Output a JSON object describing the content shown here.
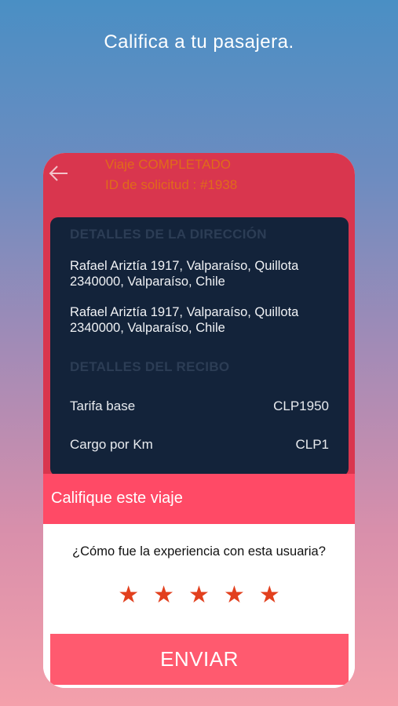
{
  "headline": "Califica a tu pasajera.",
  "trip": {
    "status": "Viaje COMPLETADO",
    "request_id": "ID de solicitud : #1938"
  },
  "address_section": {
    "title": "DETALLES DE LA DIRECCIÓN",
    "pickup": "Rafael Ariztía 1917, Valparaíso, Quillota 2340000, Valparaíso, Chile",
    "dropoff": "Rafael Ariztía 1917, Valparaíso, Quillota 2340000, Valparaíso, Chile"
  },
  "receipt_section": {
    "title": "DETALLES DEL RECIBO",
    "rows": [
      {
        "label": "Tarifa base",
        "value": "CLP1950"
      },
      {
        "label": "Cargo por Km",
        "value": "CLP1"
      }
    ]
  },
  "rating": {
    "title": "Califique este viaje",
    "question": "¿Cómo fue la experiencia con esta usuaria?",
    "stars": [
      "★",
      "★",
      "★",
      "★",
      "★"
    ],
    "selected": 5,
    "max": 5,
    "submit_label": "ENVIAR"
  },
  "colors": {
    "header": "#d9364e",
    "card": "#13233a",
    "accent": "#ff4a66",
    "star": "#e2401e",
    "status_text": "#e06a1a"
  },
  "icons": {
    "back": "arrow-left-icon",
    "star": "star-icon"
  }
}
